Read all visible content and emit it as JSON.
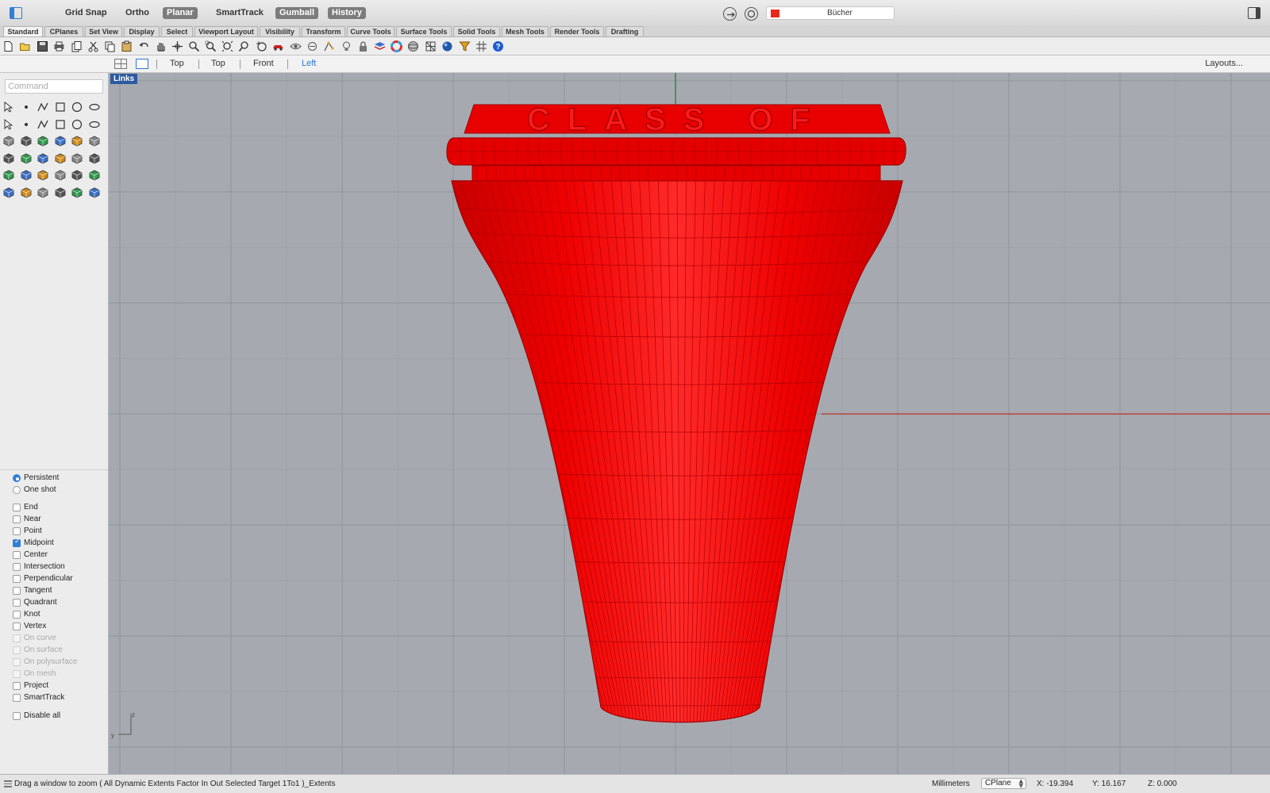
{
  "top_bar": {
    "modes": [
      {
        "label": "Grid Snap",
        "on": false
      },
      {
        "label": "Ortho",
        "on": false
      },
      {
        "label": "Planar",
        "on": true
      },
      {
        "label": "SmartTrack",
        "on": false
      },
      {
        "label": "Gumball",
        "on": true
      },
      {
        "label": "History",
        "on": true
      }
    ],
    "layer": {
      "name": "Bücher",
      "color": "#e8281e"
    }
  },
  "tabs": [
    "Standard",
    "CPlanes",
    "Set View",
    "Display",
    "Select",
    "Viewport Layout",
    "Visibility",
    "Transform",
    "Curve Tools",
    "Surface Tools",
    "Solid Tools",
    "Mesh Tools",
    "Render Tools",
    "Drafting"
  ],
  "active_tab": "Standard",
  "view_bar": {
    "views": [
      "Top",
      "Top",
      "Front",
      "Left"
    ],
    "active_view": "Left",
    "layouts_label": "Layouts..."
  },
  "command": {
    "placeholder": "Command"
  },
  "osnap": {
    "mode_options": [
      {
        "label": "Persistent",
        "selected": true
      },
      {
        "label": "One shot",
        "selected": false
      }
    ],
    "options": [
      {
        "label": "End",
        "checked": false,
        "enabled": true
      },
      {
        "label": "Near",
        "checked": false,
        "enabled": true
      },
      {
        "label": "Point",
        "checked": false,
        "enabled": true
      },
      {
        "label": "Midpoint",
        "checked": true,
        "enabled": true
      },
      {
        "label": "Center",
        "checked": false,
        "enabled": true
      },
      {
        "label": "Intersection",
        "checked": false,
        "enabled": true
      },
      {
        "label": "Perpendicular",
        "checked": false,
        "enabled": true
      },
      {
        "label": "Tangent",
        "checked": false,
        "enabled": true
      },
      {
        "label": "Quadrant",
        "checked": false,
        "enabled": true
      },
      {
        "label": "Knot",
        "checked": false,
        "enabled": true
      },
      {
        "label": "Vertex",
        "checked": false,
        "enabled": true
      },
      {
        "label": "On curve",
        "checked": false,
        "enabled": false
      },
      {
        "label": "On surface",
        "checked": false,
        "enabled": false
      },
      {
        "label": "On polysurface",
        "checked": false,
        "enabled": false
      },
      {
        "label": "On mesh",
        "checked": false,
        "enabled": false
      },
      {
        "label": "Project",
        "checked": false,
        "enabled": true
      },
      {
        "label": "SmartTrack",
        "checked": false,
        "enabled": true
      }
    ],
    "disable_all": {
      "label": "Disable all",
      "checked": false
    }
  },
  "viewport": {
    "label": "Links",
    "model_text": "CLASS OF",
    "object_color": "#ff0000",
    "axis_labels": {
      "z": "z",
      "y": "y"
    }
  },
  "status": {
    "message": "Drag a window to zoom ( All Dynamic Extents Factor In Out Selected Target 1To1 )_Extents",
    "units": "Millimeters",
    "cplane": "CPlane",
    "x": "X: -19.394",
    "y": "Y: 16.167",
    "z": "Z: 0.000"
  },
  "icons": {
    "top_bar": [
      "left-panel-toggle-icon",
      "osnap-toggle-icon",
      "target-icon",
      "right-panel-toggle-icon"
    ],
    "toolbar": [
      "new-file-icon",
      "open-file-icon",
      "save-icon",
      "print-icon",
      "copy-to-clipboard-icon",
      "cut-icon",
      "copy-icon",
      "paste-icon",
      "undo-icon",
      "pan-hand-icon",
      "rotate-view-icon",
      "zoom-icon",
      "zoom-window-icon",
      "zoom-extents-icon",
      "zoom-selected-icon",
      "undo-view-icon",
      "car-icon",
      "visibility-eye-icon",
      "isolate-icon",
      "transform-icon",
      "lightbulb-icon",
      "lock-icon",
      "layer-icon",
      "color-wheel-icon",
      "render-sphere-icon",
      "mesh-icon",
      "display-mode-icon",
      "material-sphere-icon",
      "filter-icon",
      "grid-icon",
      "help-icon"
    ]
  }
}
